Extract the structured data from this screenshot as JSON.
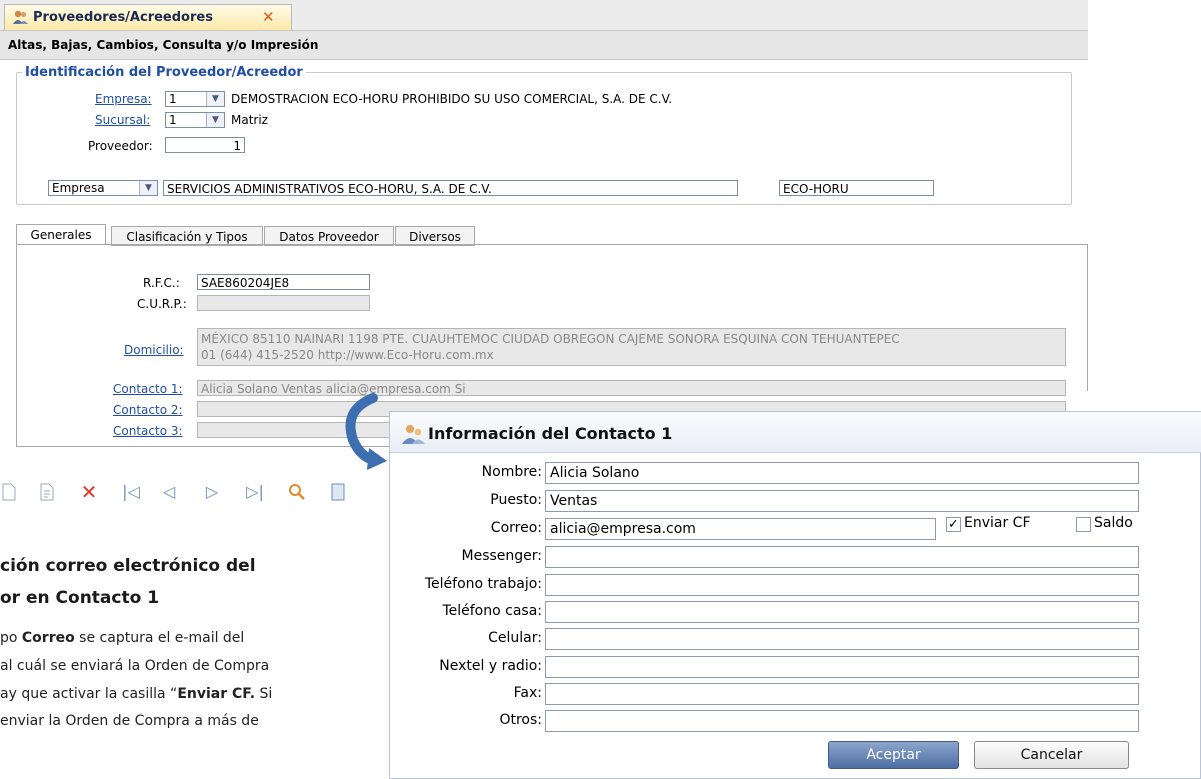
{
  "window_tab": {
    "title": "Proveedores/Acreedores",
    "close_icon": "close-icon"
  },
  "subtitle": "Altas, Bajas, Cambios, Consulta y/o Impresión",
  "identificacion": {
    "legend": "Identificación del Proveedor/Acreedor",
    "empresa_label": "Empresa:",
    "empresa_value": "1",
    "empresa_name": "DEMOSTRACION ECO-HORU PROHIBIDO SU USO COMERCIAL, S.A. DE C.V.",
    "sucursal_label": "Sucursal:",
    "sucursal_value": "1",
    "sucursal_name": "Matriz",
    "proveedor_label": "Proveedor:",
    "proveedor_value": "1",
    "tipo_value": "Empresa",
    "razon_social": "SERVICIOS ADMINISTRATIVOS ECO-HORU, S.A. DE C.V.",
    "nombre_corto": "ECO-HORU"
  },
  "tabs": [
    "Generales",
    "Clasificación y Tipos",
    "Datos Proveedor",
    "Diversos"
  ],
  "generales": {
    "rfc_label": "R.F.C.:",
    "rfc_value": "SAE860204JE8",
    "curp_label": "C.U.R.P.:",
    "curp_value": "",
    "domicilio_label": "Domicilio:",
    "domicilio_line1": "MÉXICO  85110  NAINARI  1198 PTE.   CUAUHTEMOC  CIUDAD OBREGON  CAJEME  SONORA  ESQUINA CON TEHUANTEPEC",
    "domicilio_line2": "01 (644) 415-2520  http://www.Eco-Horu.com.mx",
    "contacto1_label": "Contacto 1:",
    "contacto1_value": "Alicia Solano  Ventas  alicia@empresa.com  Si",
    "contacto2_label": "Contacto 2:",
    "contacto2_value": "",
    "contacto3_label": "Contacto 3:",
    "contacto3_value": ""
  },
  "toolbar_icons": [
    "new-icon",
    "edit-icon",
    "delete-icon",
    "first-icon",
    "prev-icon",
    "next-icon",
    "last-icon",
    "search-icon",
    "save-icon"
  ],
  "doc": {
    "heading1": "ción correo electrónico del",
    "heading2": "or en Contacto 1",
    "line1_a": "po ",
    "line1_b": "Correo",
    "line1_c": " se captura el e-mail del",
    "line2": "al cuál se enviará la Orden de Compra",
    "line3_a": "ay que activar la casilla  “",
    "line3_b": "Enviar CF.",
    "line3_c": " Si",
    "line4": " enviar la Orden de Compra a más de"
  },
  "dialog": {
    "title": "Información del Contacto 1",
    "fields": [
      {
        "label": "Nombre:",
        "value": "Alicia Solano"
      },
      {
        "label": "Puesto:",
        "value": "Ventas"
      },
      {
        "label": "Correo:",
        "value": "alicia@empresa.com"
      },
      {
        "label": "Messenger:",
        "value": ""
      },
      {
        "label": "Teléfono trabajo:",
        "value": ""
      },
      {
        "label": "Teléfono casa:",
        "value": ""
      },
      {
        "label": "Celular:",
        "value": ""
      },
      {
        "label": "Nextel y radio:",
        "value": ""
      },
      {
        "label": "Fax:",
        "value": ""
      },
      {
        "label": "Otros:",
        "value": ""
      }
    ],
    "enviar_cf_label": "Enviar CF",
    "enviar_cf_checked": true,
    "saldo_label": "Saldo",
    "saldo_checked": false,
    "accept_label": "Aceptar",
    "cancel_label": "Cancelar"
  },
  "colors": {
    "link": "#1f4ea3",
    "accent": "#4e6ea3",
    "arrow": "#3d6fb0"
  }
}
